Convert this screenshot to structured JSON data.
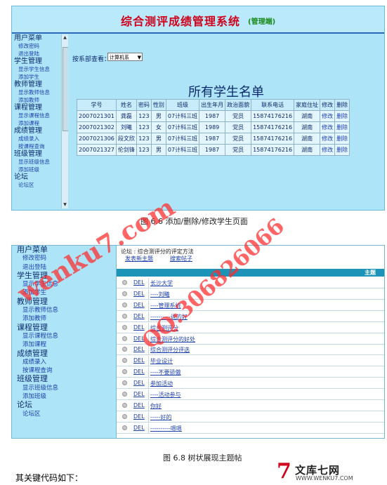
{
  "figure1": {
    "app_title": "综合测评成绩管理系统",
    "app_role": "(管理端)",
    "sidebar": [
      {
        "heading": "用户菜单",
        "items": [
          "修改密码",
          "退出登陆"
        ]
      },
      {
        "heading": "学生管理",
        "items": [
          "显示学生信息",
          "添加学生"
        ]
      },
      {
        "heading": "教师管理",
        "items": [
          "显示教师信息",
          "添加教师"
        ]
      },
      {
        "heading": "课程管理",
        "items": [
          "显示课程信息",
          "添加课程"
        ]
      },
      {
        "heading": "成绩管理",
        "items": [
          "成绩录入",
          "按课程查询"
        ]
      },
      {
        "heading": "班级管理",
        "items": [
          "显示班级信息",
          "添加班级"
        ]
      },
      {
        "heading": "论坛",
        "items": [
          "论坛区"
        ]
      }
    ],
    "filter_label": "按系部查看：",
    "dept_selected": "计算机系",
    "list_title": "所有学生名单",
    "columns": [
      "学号",
      "姓名",
      "密码",
      "性别",
      "班级",
      "出生年月",
      "政治面貌",
      "联系电话",
      "家庭住址",
      "修改",
      "删除"
    ],
    "rows": [
      [
        "2007021301",
        "龚磊",
        "123",
        "男",
        "07计科三班",
        "1987",
        "党员",
        "15874176216",
        "湖南",
        "修改",
        "删除"
      ],
      [
        "2007021302",
        "刘曦",
        "123",
        "女",
        "07计科三班",
        "1989",
        "党员",
        "15874176216",
        "湖南",
        "修改",
        "删除"
      ],
      [
        "2007021306",
        "段文欣",
        "123",
        "男",
        "07计科三班",
        "1987",
        "党员",
        "15874176216",
        "湖南",
        "修改",
        "删除"
      ],
      [
        "2007021327",
        "伦剑锋",
        "123",
        "男",
        "07计科三班",
        "1987",
        "党员",
        "15874176216",
        "湖南",
        "修改",
        "删除"
      ]
    ],
    "caption": "图 6.6  添加/删除/修改学生页面"
  },
  "figure2": {
    "sidebar": [
      {
        "heading": "用户菜单",
        "items": [
          "修改密码",
          "退出登陆"
        ]
      },
      {
        "heading": "学生管理",
        "items": [
          "显示学生信息",
          "添加学生"
        ]
      },
      {
        "heading": "教师管理",
        "items": [
          "显示教师信息",
          "添加教师"
        ]
      },
      {
        "heading": "课程管理",
        "items": [
          "显示课程信息",
          "添加课程"
        ]
      },
      {
        "heading": "成绩管理",
        "items": [
          "成绩录入",
          "按课程查询"
        ]
      },
      {
        "heading": "班级管理",
        "items": [
          "显示班级信息",
          "添加班级"
        ]
      },
      {
        "heading": "论坛",
        "items": [
          "论坛区"
        ]
      }
    ],
    "breadcrumb": "论坛 : 综合测评分的评定方法",
    "post_new": "发表新主题",
    "post_search": "搜索帖子",
    "topics_header": "主题",
    "del_label": "DEL",
    "topics": [
      "长沙大学",
      "----刘曦",
      "----管理系统",
      "----------说的好",
      "综合测评分",
      "综合测评分的好处",
      "综合测评分评选",
      "毕业设计",
      "----不要骄傲",
      "参加活动",
      "----活动参与",
      "你好",
      "-----好的",
      "----------嗯嗯"
    ],
    "caption": "图 6.8  树状展现主题帖"
  },
  "footer_text": "其关键代码如下：",
  "logo": {
    "mark": "7",
    "name": "文库七网",
    "url": "WWW.WENKU7.COM"
  },
  "watermarks": {
    "site": "wenku7.com",
    "qq": "QQ:306826066"
  }
}
